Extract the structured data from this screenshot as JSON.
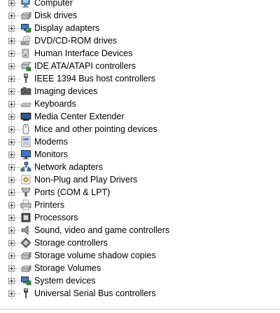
{
  "tree": {
    "items": [
      {
        "label": "Computer",
        "icon": "computer-icon"
      },
      {
        "label": "Disk drives",
        "icon": "disk-drive-icon"
      },
      {
        "label": "Display adapters",
        "icon": "display-adapter-icon"
      },
      {
        "label": "DVD/CD-ROM drives",
        "icon": "optical-drive-icon"
      },
      {
        "label": "Human Interface Devices",
        "icon": "hid-icon"
      },
      {
        "label": "IDE ATA/ATAPI controllers",
        "icon": "ide-controller-icon"
      },
      {
        "label": "IEEE 1394 Bus host controllers",
        "icon": "ieee1394-icon"
      },
      {
        "label": "Imaging devices",
        "icon": "camera-icon"
      },
      {
        "label": "Keyboards",
        "icon": "keyboard-icon"
      },
      {
        "label": "Media Center Extender",
        "icon": "media-center-icon"
      },
      {
        "label": "Mice and other pointing devices",
        "icon": "mouse-icon"
      },
      {
        "label": "Modems",
        "icon": "modem-icon"
      },
      {
        "label": "Monitors",
        "icon": "monitor-icon"
      },
      {
        "label": "Network adapters",
        "icon": "network-icon"
      },
      {
        "label": "Non-Plug and Play Drivers",
        "icon": "driver-icon"
      },
      {
        "label": "Ports (COM & LPT)",
        "icon": "port-icon"
      },
      {
        "label": "Printers",
        "icon": "printer-icon"
      },
      {
        "label": "Processors",
        "icon": "processor-icon"
      },
      {
        "label": "Sound, video and game controllers",
        "icon": "speaker-icon"
      },
      {
        "label": "Storage controllers",
        "icon": "storage-controller-icon"
      },
      {
        "label": "Storage volume shadow copies",
        "icon": "shadow-copy-icon"
      },
      {
        "label": "Storage Volumes",
        "icon": "storage-volume-icon"
      },
      {
        "label": "System devices",
        "icon": "system-device-icon"
      },
      {
        "label": "Universal Serial Bus controllers",
        "icon": "usb-icon"
      }
    ]
  },
  "colors": {
    "text": "#000000",
    "background": "#ffffff",
    "tree_line": "#a0a0a0"
  }
}
